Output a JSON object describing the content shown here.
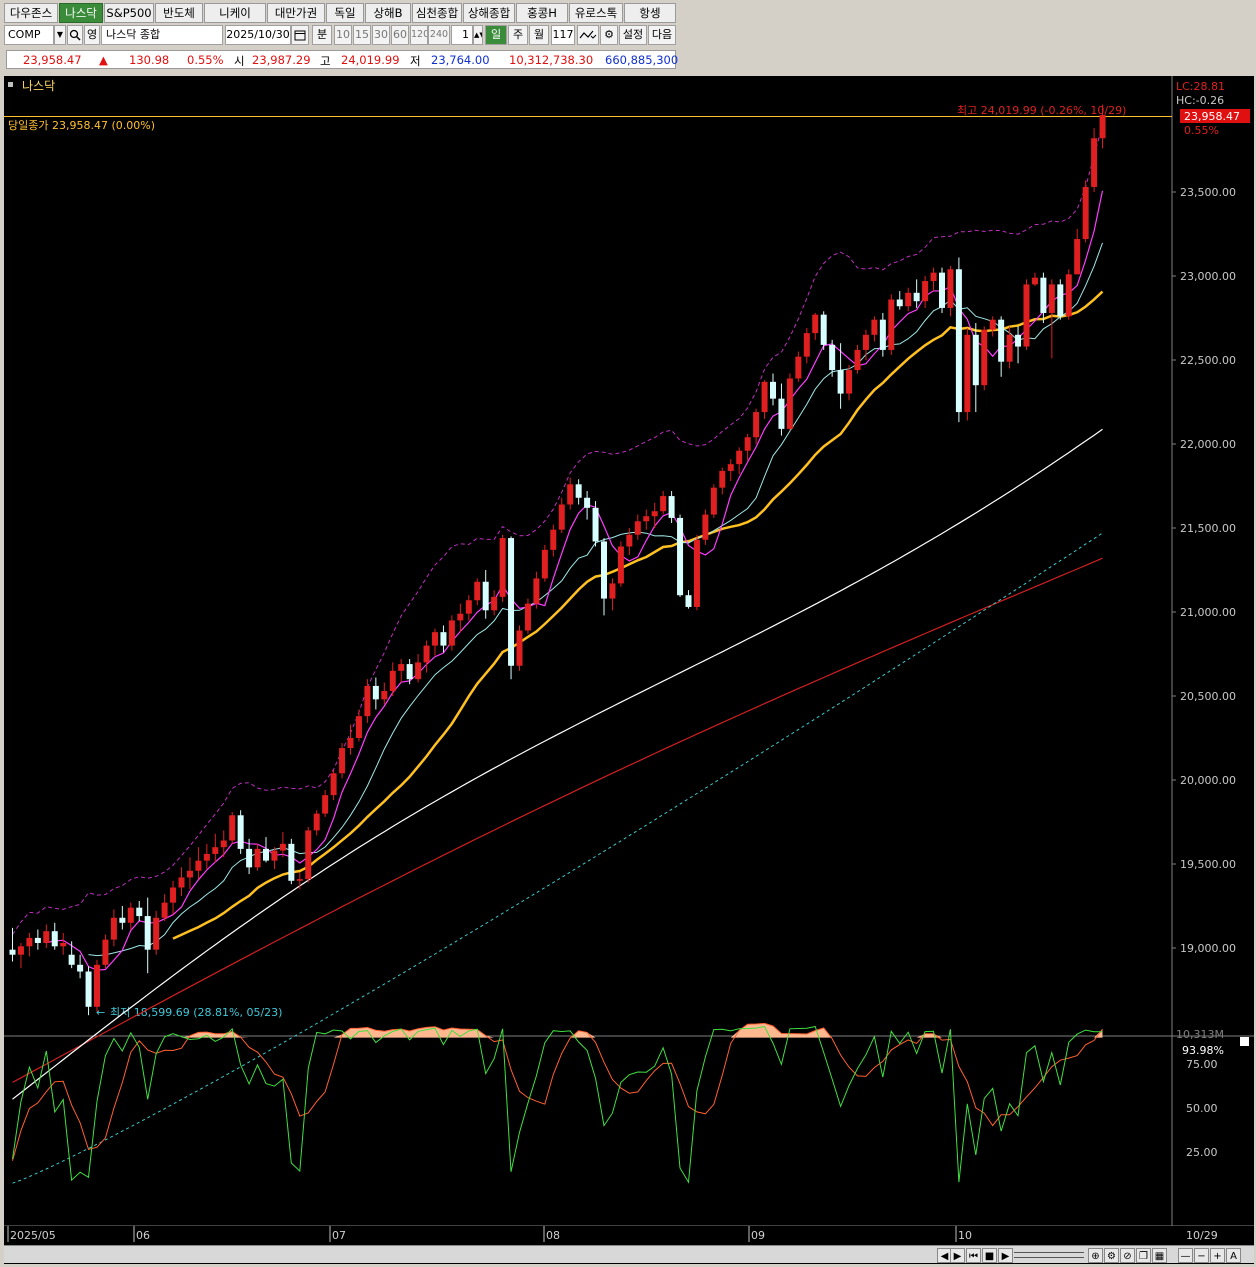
{
  "tabs": [
    "다우존스",
    "나스닥",
    "S&P500",
    "반도체",
    "니케이",
    "대만가권",
    "독일",
    "상해B",
    "심천종합",
    "상해종합",
    "홍콩H",
    "유로스톡",
    "항셍"
  ],
  "active_tab": 1,
  "toolbar": {
    "code": "COMP",
    "search_icon": "search-icon",
    "type_label": "영",
    "name": "나스닥 종합",
    "date": "2025/10/30",
    "period_unit": "분",
    "intervals": [
      "10",
      "15",
      "30",
      "60",
      "120",
      "240"
    ],
    "count_value": "1",
    "day_label": "일",
    "week_label": "주",
    "month_label": "월",
    "bars": "117",
    "settings_label": "설정",
    "next_label": "다음"
  },
  "quote": {
    "price": "23,958.47",
    "change_arrow": "▲",
    "change": "130.98",
    "change_pct": "0.55%",
    "open_label": "시",
    "open": "23,987.29",
    "high_label": "고",
    "high": "24,019.99",
    "low_label": "저",
    "low": "23,764.00",
    "volume": "10,312,738.30",
    "amount": "660,885,300",
    "colors": {
      "up": "#e01010",
      "down": "#1030d0",
      "neutral": "#000000"
    }
  },
  "chart": {
    "title": "나스닥",
    "prev_close_label": "당일종가 23,958.47 (0.00%)",
    "high_annotation": "최고 24,019.99 (-0.26%, 10/29)",
    "low_annotation": "최저 18,599.69 (28.81%, 05/23)",
    "lc_label": "LC:28.81",
    "hc_label": "HC:-0.26",
    "current_price_tag": "23,958.47",
    "current_pct_tag": "0.55%",
    "volume_axis_label": "10,313M",
    "osc_value_tag": "93.98%",
    "price_ticks": [
      "23,500.00",
      "23,000.00",
      "22,500.00",
      "22,000.00",
      "21,500.00",
      "21,000.00",
      "20,500.00",
      "20,000.00",
      "19,500.00",
      "19,000.00"
    ],
    "osc_ticks": [
      "75.00",
      "50.00",
      "25.00"
    ],
    "x_labels": [
      "2025/05",
      "06",
      "07",
      "08",
      "09",
      "10"
    ],
    "x_end_label": "10/29",
    "colors": {
      "up": "#e02020",
      "down": "#d8ffff",
      "ma5": "#ff3cff",
      "ma10": "#9ee8e8",
      "ma20": "#ffc020",
      "ma60": "#ffffff",
      "ma120": "#d02020",
      "ma120b": "#40c8c8",
      "bb": "#c030c0",
      "stochK": "#40e040",
      "stochD": "#ff6030",
      "fill": "#ffb890"
    }
  },
  "chart_data": {
    "type": "candlestick",
    "title": "나스닥",
    "ylim": [
      18400,
      24200
    ],
    "osc_ylim": [
      0,
      100
    ],
    "candles": [
      [
        18990,
        19120,
        18920,
        18960
      ],
      [
        18960,
        19030,
        18880,
        19010
      ],
      [
        19010,
        19090,
        18950,
        19060
      ],
      [
        19060,
        19110,
        18990,
        19030
      ],
      [
        19030,
        19140,
        19000,
        19100
      ],
      [
        19100,
        19150,
        18990,
        19010
      ],
      [
        19010,
        19090,
        18960,
        19030
      ],
      [
        18960,
        19040,
        18880,
        18900
      ],
      [
        18900,
        18960,
        18820,
        18860
      ],
      [
        18860,
        18890,
        18600,
        18650
      ],
      [
        18650,
        18930,
        18620,
        18900
      ],
      [
        18900,
        19080,
        18880,
        19050
      ],
      [
        19050,
        19230,
        19010,
        19180
      ],
      [
        19180,
        19250,
        19110,
        19150
      ],
      [
        19150,
        19270,
        19110,
        19240
      ],
      [
        19240,
        19280,
        19160,
        19190
      ],
      [
        19190,
        19300,
        18850,
        18990
      ],
      [
        18990,
        19220,
        18960,
        19180
      ],
      [
        19180,
        19320,
        19160,
        19270
      ],
      [
        19270,
        19400,
        19200,
        19360
      ],
      [
        19360,
        19480,
        19310,
        19420
      ],
      [
        19420,
        19540,
        19350,
        19460
      ],
      [
        19460,
        19600,
        19410,
        19520
      ],
      [
        19520,
        19620,
        19470,
        19560
      ],
      [
        19560,
        19680,
        19510,
        19600
      ],
      [
        19600,
        19700,
        19540,
        19640
      ],
      [
        19640,
        19810,
        19620,
        19790
      ],
      [
        19790,
        19820,
        19560,
        19590
      ],
      [
        19590,
        19650,
        19440,
        19480
      ],
      [
        19480,
        19620,
        19460,
        19590
      ],
      [
        19590,
        19660,
        19510,
        19520
      ],
      [
        19520,
        19600,
        19470,
        19580
      ],
      [
        19580,
        19690,
        19540,
        19620
      ],
      [
        19620,
        19650,
        19380,
        19400
      ],
      [
        19400,
        19450,
        19350,
        19410
      ],
      [
        19410,
        19720,
        19390,
        19700
      ],
      [
        19700,
        19820,
        19670,
        19800
      ],
      [
        19800,
        19940,
        19780,
        19910
      ],
      [
        19910,
        20060,
        19880,
        20040
      ],
      [
        20040,
        20220,
        20010,
        20190
      ],
      [
        20190,
        20330,
        20150,
        20250
      ],
      [
        20250,
        20420,
        20230,
        20380
      ],
      [
        20380,
        20600,
        20340,
        20560
      ],
      [
        20560,
        20610,
        20420,
        20480
      ],
      [
        20480,
        20580,
        20450,
        20530
      ],
      [
        20530,
        20700,
        20500,
        20650
      ],
      [
        20650,
        20720,
        20580,
        20690
      ],
      [
        20690,
        20720,
        20570,
        20600
      ],
      [
        20600,
        20750,
        20580,
        20700
      ],
      [
        20700,
        20830,
        20640,
        20800
      ],
      [
        20800,
        20900,
        20740,
        20880
      ],
      [
        20880,
        20920,
        20760,
        20800
      ],
      [
        20800,
        20980,
        20770,
        20950
      ],
      [
        20950,
        21050,
        20880,
        20990
      ],
      [
        20990,
        21100,
        20950,
        21070
      ],
      [
        21070,
        21200,
        21040,
        21180
      ],
      [
        21180,
        21250,
        20960,
        21010
      ],
      [
        21010,
        21130,
        20980,
        21090
      ],
      [
        21090,
        21460,
        21060,
        21440
      ],
      [
        21440,
        21450,
        20600,
        20680
      ],
      [
        20680,
        20920,
        20650,
        20890
      ],
      [
        20890,
        21080,
        20870,
        21050
      ],
      [
        21050,
        21240,
        21020,
        21200
      ],
      [
        21200,
        21400,
        21180,
        21370
      ],
      [
        21370,
        21520,
        21330,
        21490
      ],
      [
        21490,
        21680,
        21470,
        21640
      ],
      [
        21640,
        21800,
        21610,
        21760
      ],
      [
        21760,
        21790,
        21640,
        21680
      ],
      [
        21680,
        21720,
        21550,
        21620
      ],
      [
        21620,
        21660,
        21390,
        21420
      ],
      [
        21420,
        21440,
        20980,
        21080
      ],
      [
        21080,
        21200,
        21010,
        21170
      ],
      [
        21170,
        21420,
        21150,
        21390
      ],
      [
        21390,
        21500,
        21340,
        21460
      ],
      [
        21460,
        21580,
        21430,
        21540
      ],
      [
        21540,
        21610,
        21490,
        21570
      ],
      [
        21570,
        21650,
        21500,
        21600
      ],
      [
        21600,
        21720,
        21580,
        21690
      ],
      [
        21690,
        21720,
        21530,
        21560
      ],
      [
        21560,
        21580,
        21090,
        21100
      ],
      [
        21100,
        21130,
        21020,
        21030
      ],
      [
        21030,
        21460,
        21010,
        21430
      ],
      [
        21430,
        21610,
        21400,
        21580
      ],
      [
        21580,
        21760,
        21560,
        21740
      ],
      [
        21740,
        21860,
        21700,
        21840
      ],
      [
        21840,
        21910,
        21780,
        21880
      ],
      [
        21880,
        21980,
        21820,
        21960
      ],
      [
        21960,
        22060,
        21900,
        22040
      ],
      [
        22040,
        22210,
        22000,
        22190
      ],
      [
        22190,
        22380,
        22150,
        22370
      ],
      [
        22370,
        22420,
        22230,
        22270
      ],
      [
        22270,
        22360,
        22050,
        22090
      ],
      [
        22090,
        22420,
        22080,
        22390
      ],
      [
        22390,
        22550,
        22370,
        22520
      ],
      [
        22520,
        22690,
        22480,
        22660
      ],
      [
        22660,
        22780,
        22620,
        22770
      ],
      [
        22770,
        22790,
        22560,
        22590
      ],
      [
        22590,
        22620,
        22400,
        22440
      ],
      [
        22440,
        22600,
        22210,
        22300
      ],
      [
        22300,
        22470,
        22260,
        22440
      ],
      [
        22440,
        22590,
        22420,
        22560
      ],
      [
        22560,
        22680,
        22500,
        22650
      ],
      [
        22650,
        22760,
        22610,
        22740
      ],
      [
        22740,
        22780,
        22520,
        22560
      ],
      [
        22560,
        22890,
        22530,
        22860
      ],
      [
        22860,
        22910,
        22800,
        22820
      ],
      [
        22820,
        22930,
        22790,
        22900
      ],
      [
        22900,
        22980,
        22810,
        22850
      ],
      [
        22850,
        23000,
        22810,
        22970
      ],
      [
        22970,
        23050,
        22910,
        23020
      ],
      [
        23020,
        23050,
        22780,
        22810
      ],
      [
        22810,
        23060,
        22760,
        23040
      ],
      [
        23040,
        23110,
        22130,
        22190
      ],
      [
        22190,
        22690,
        22140,
        22650
      ],
      [
        22650,
        22720,
        22190,
        22350
      ],
      [
        22350,
        22700,
        22320,
        22680
      ],
      [
        22680,
        22760,
        22640,
        22740
      ],
      [
        22740,
        22760,
        22400,
        22490
      ],
      [
        22490,
        22700,
        22450,
        22650
      ],
      [
        22650,
        22700,
        22480,
        22580
      ],
      [
        22580,
        22980,
        22560,
        22950
      ],
      [
        22950,
        23020,
        22940,
        22990
      ],
      [
        22990,
        23020,
        22720,
        22780
      ],
      [
        22780,
        22980,
        22510,
        22950
      ],
      [
        22950,
        22980,
        22740,
        22760
      ],
      [
        22760,
        23040,
        22740,
        23010
      ],
      [
        23010,
        23280,
        23010,
        23220
      ],
      [
        23220,
        23570,
        23200,
        23530
      ],
      [
        23530,
        23880,
        23500,
        23820
      ],
      [
        23820,
        24020,
        23760,
        23958
      ]
    ]
  }
}
